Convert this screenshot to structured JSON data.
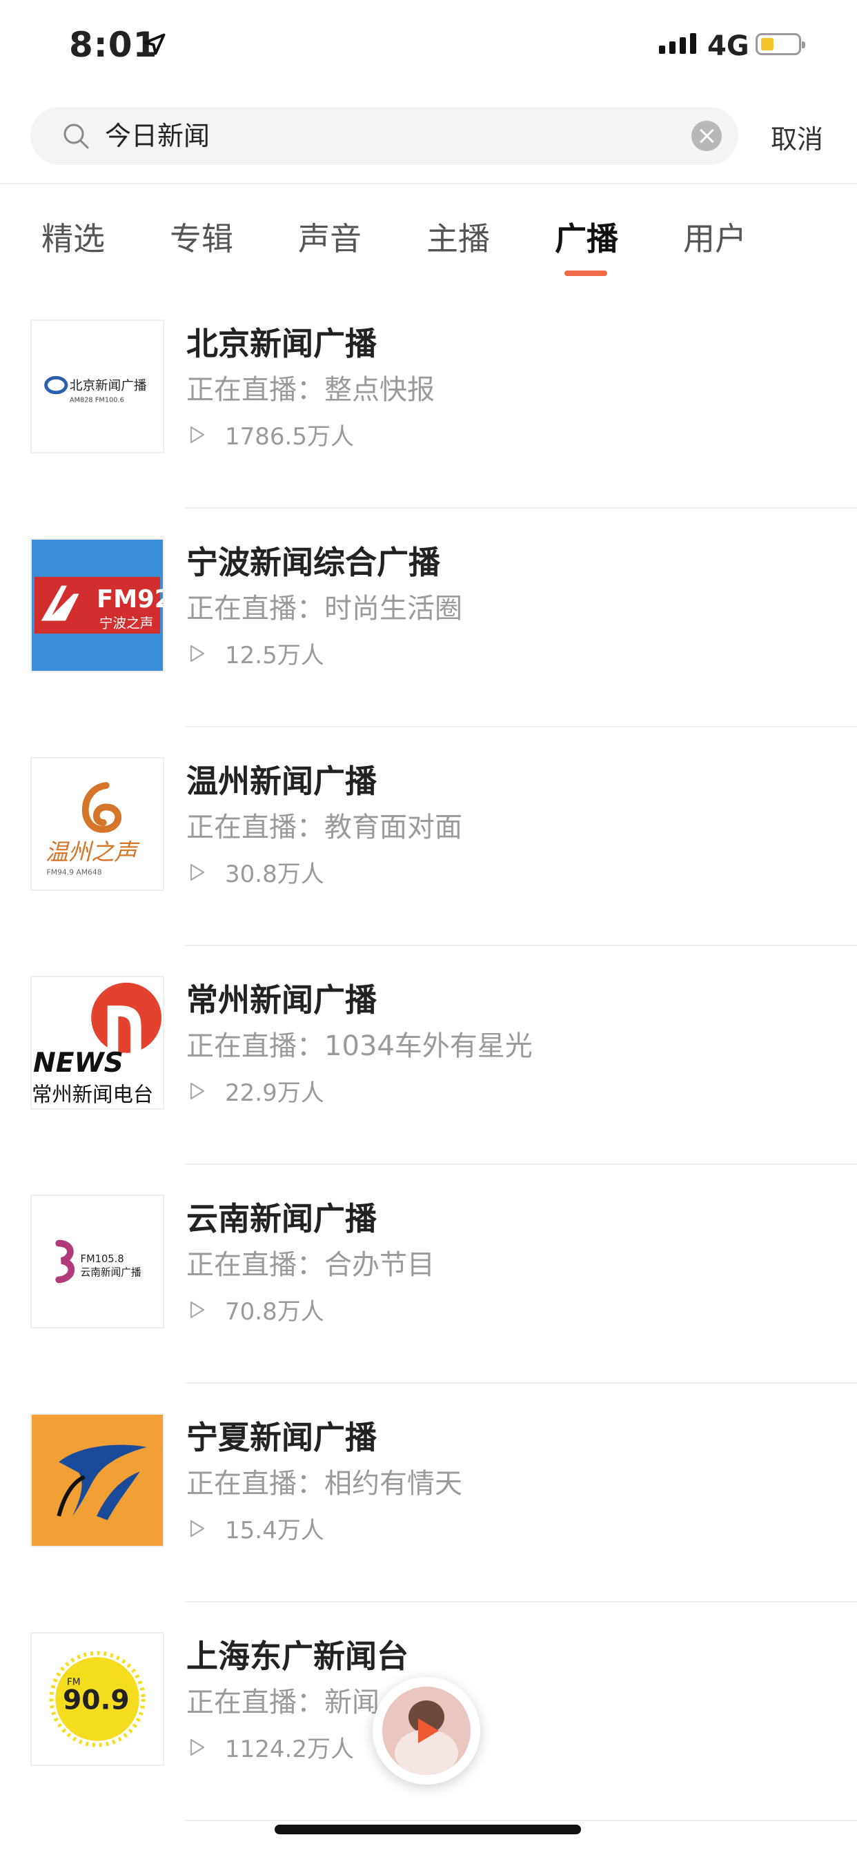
{
  "status_bar": {
    "time": "8:01",
    "network": "4G",
    "battery_level": 0.35
  },
  "search": {
    "query": "今日新闻",
    "cancel_label": "取消"
  },
  "tabs": [
    {
      "label": "精选"
    },
    {
      "label": "专辑"
    },
    {
      "label": "声音"
    },
    {
      "label": "主播"
    },
    {
      "label": "广播",
      "active": true
    },
    {
      "label": "用户"
    }
  ],
  "stations": [
    {
      "name": "北京新闻广播",
      "live": "正在直播：整点快报",
      "plays": "1786.5万人",
      "logo_text": "北京新闻广播",
      "logo_sub": "AM828 FM100.6"
    },
    {
      "name": "宁波新闻综合广播",
      "live": "正在直播：时尚生活圈",
      "plays": "12.5万人",
      "logo_text": "FM92",
      "logo_sub": "宁波之声"
    },
    {
      "name": "温州新闻广播",
      "live": "正在直播：教育面对面",
      "plays": "30.8万人",
      "logo_text": "温州之声",
      "logo_sub": "FM94.9 AM648"
    },
    {
      "name": "常州新闻广播",
      "live": "正在直播：1034车外有星光",
      "plays": "22.9万人",
      "logo_text": "NEWS",
      "logo_sub": "常州新闻电台"
    },
    {
      "name": "云南新闻广播",
      "live": "正在直播：合办节目",
      "plays": "70.8万人",
      "logo_text": "FM105.8",
      "logo_sub": "云南新闻广播"
    },
    {
      "name": "宁夏新闻广播",
      "live": "正在直播：相约有情天",
      "plays": "15.4万人"
    },
    {
      "name": "上海东广新闻台",
      "live": "正在直播：新闻",
      "plays": "1124.2万人",
      "logo_text": "90.9",
      "logo_sub": "FM"
    }
  ],
  "colors": {
    "accent": "#ef6c4a",
    "muted_text": "#9a9a9a"
  }
}
